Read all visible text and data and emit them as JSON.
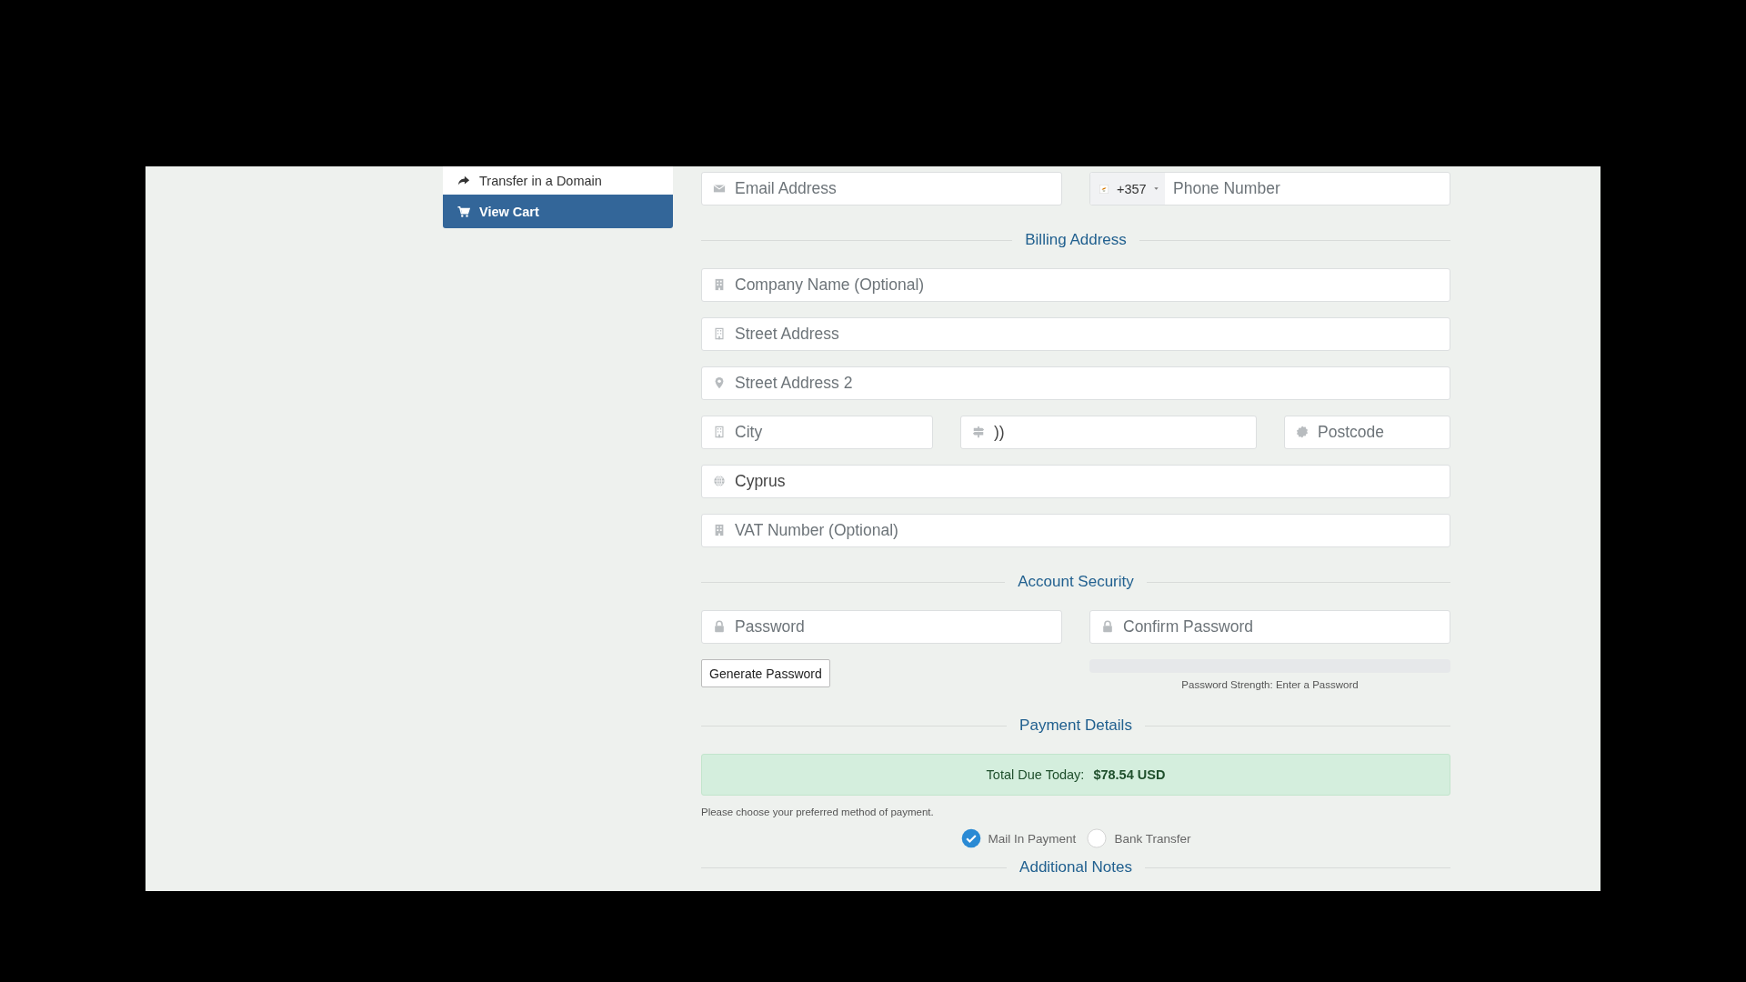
{
  "sidebar": {
    "items": [
      {
        "label": "Transfer in a Domain",
        "selected": false
      },
      {
        "label": "View Cart",
        "selected": true
      }
    ]
  },
  "contact": {
    "email": {
      "placeholder": "Email Address"
    },
    "phone": {
      "country_code": "+357",
      "placeholder": "Phone Number"
    }
  },
  "billing_address": {
    "heading": "Billing Address",
    "rows": [
      [
        {
          "placeholder": "Company Name (Optional)"
        }
      ],
      [
        {
          "placeholder": "Street Address"
        }
      ],
      [
        {
          "placeholder": "Street Address 2"
        }
      ],
      [
        {
          "placeholder": "City"
        },
        {
          "value": "))"
        },
        {
          "placeholder": "Postcode"
        }
      ],
      [
        {
          "value": "Cyprus"
        }
      ],
      [
        {
          "placeholder": "VAT Number (Optional)"
        }
      ]
    ]
  },
  "account_security": {
    "heading": "Account Security",
    "password": {
      "placeholder": "Password"
    },
    "confirm_password": {
      "placeholder": "Confirm Password"
    },
    "generate_button": "Generate Password",
    "strength": {
      "level": 0,
      "label": "Password Strength: Enter a Password"
    }
  },
  "payment_details": {
    "heading": "Payment Details",
    "total": "Total Due Today: **$78.54 USD**",
    "prompt": "Please choose your preferred method of payment.",
    "methods": [
      {
        "label": "Mail In Payment",
        "selected": true
      },
      {
        "label": "Bank Transfer",
        "selected": false
      }
    ]
  },
  "additional_notes": {
    "heading": "Additional Notes"
  }
}
